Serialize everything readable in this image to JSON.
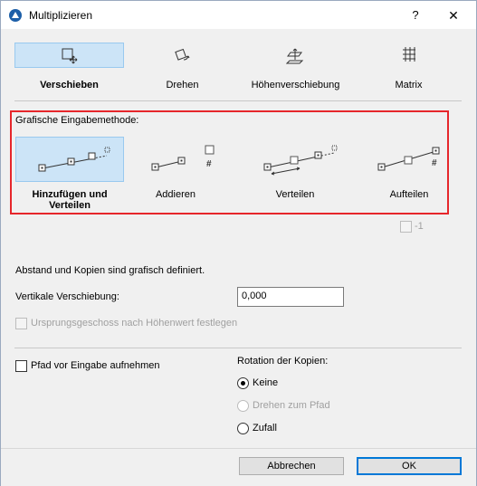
{
  "window": {
    "title": "Multiplizieren",
    "help": "?",
    "close": "✕"
  },
  "tabs": [
    {
      "label": "Verschieben",
      "icon": "move-icon",
      "selected": true
    },
    {
      "label": "Drehen",
      "icon": "rotate-icon",
      "selected": false
    },
    {
      "label": "Höhenverschiebung",
      "icon": "elevate-icon",
      "selected": false
    },
    {
      "label": "Matrix",
      "icon": "matrix-icon",
      "selected": false
    }
  ],
  "grafisch": {
    "title": "Grafische Eingabemethode:",
    "methods": [
      {
        "label": "Hinzufügen und Verteilen",
        "icon": "spread-icon",
        "selected": true
      },
      {
        "label": "Addieren",
        "icon": "increment-icon",
        "selected": false
      },
      {
        "label": "Verteilen",
        "icon": "distribute-icon",
        "selected": false
      },
      {
        "label": "Aufteilen",
        "icon": "divide-icon",
        "selected": false
      }
    ],
    "minus_one_label": "-1"
  },
  "info_text": "Abstand und Kopien sind grafisch definiert.",
  "vertical": {
    "label": "Vertikale Verschiebung:",
    "value": "0,000"
  },
  "ursprung_label": "Ursprungsgeschoss nach Höhenwert festlegen",
  "pfad_label": "Pfad vor Eingabe aufnehmen",
  "rotation": {
    "title": "Rotation der Kopien:",
    "options": [
      {
        "label": "Keine",
        "checked": true,
        "disabled": false
      },
      {
        "label": "Drehen zum Pfad",
        "checked": false,
        "disabled": true
      },
      {
        "label": "Zufall",
        "checked": false,
        "disabled": false
      }
    ]
  },
  "buttons": {
    "cancel": "Abbrechen",
    "ok": "OK"
  },
  "colors": {
    "selected_bg": "#cce4f7",
    "highlight_border": "#e6262b",
    "default_button": "#0078d7"
  }
}
